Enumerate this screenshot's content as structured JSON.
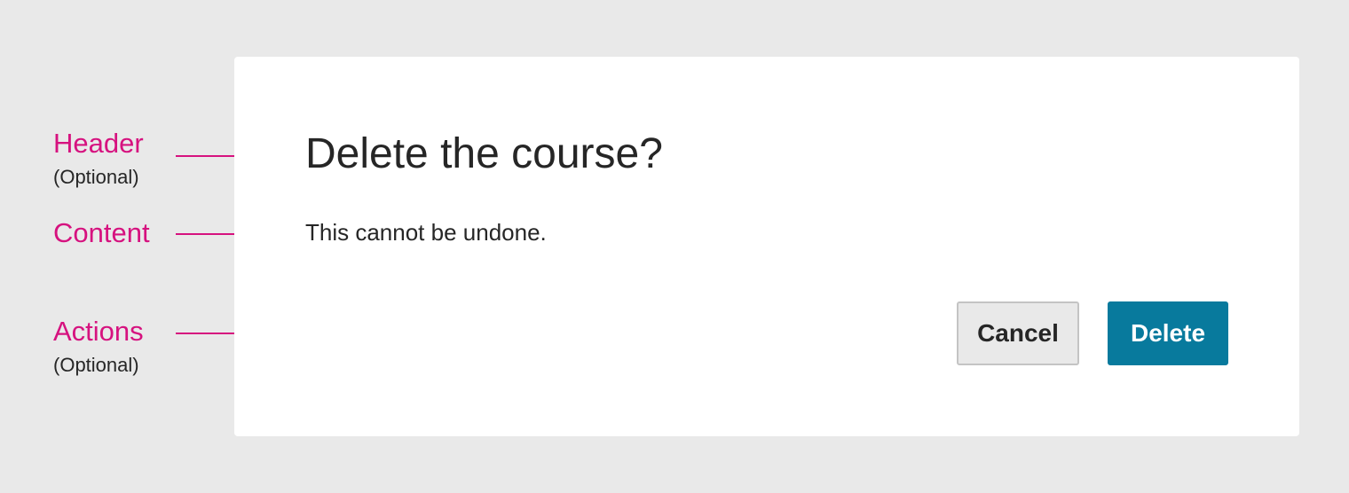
{
  "dialog": {
    "title": "Delete the course?",
    "body": "This cannot be undone.",
    "actions": {
      "cancel_label": "Cancel",
      "delete_label": "Delete"
    }
  },
  "annotations": {
    "header": {
      "label": "Header",
      "note": "(Optional)"
    },
    "content": {
      "label": "Content"
    },
    "actions": {
      "label": "Actions",
      "note": "(Optional)"
    }
  },
  "colors": {
    "background": "#e9e9e9",
    "dialog_background": "#ffffff",
    "annotation_accent": "#d6127f",
    "primary_button": "#087a9d",
    "secondary_button": "#e9e9e9",
    "text": "#262626"
  }
}
